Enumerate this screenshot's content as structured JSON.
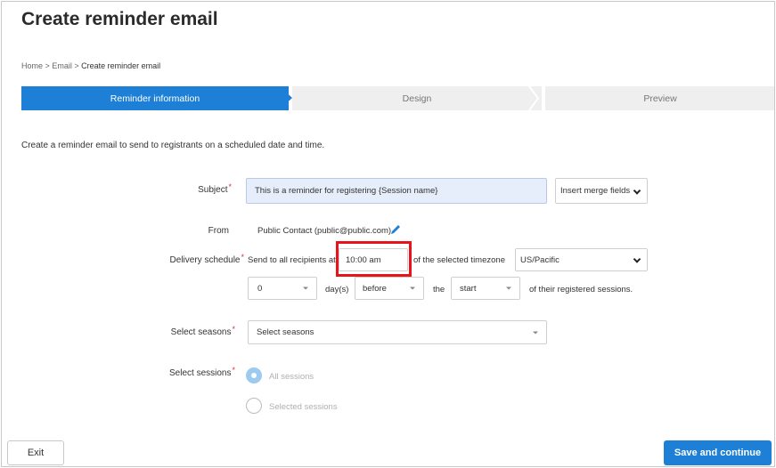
{
  "page": {
    "title": "Create reminder email"
  },
  "breadcrumb": {
    "home": "Home",
    "sep1": ">",
    "email": "Email",
    "sep2": ">",
    "current": "Create reminder email"
  },
  "steps": [
    {
      "label": "Reminder information",
      "active": true
    },
    {
      "label": "Design",
      "active": false
    },
    {
      "label": "Preview",
      "active": false
    }
  ],
  "intro": "Create a reminder email to send to registrants on a scheduled date and time.",
  "form": {
    "subject": {
      "label": "Subject",
      "required": "*",
      "value": "This is a reminder for registering {Session name}",
      "merge_button": "Insert merge fields"
    },
    "from": {
      "label": "From",
      "value": "Public Contact (public@public.com)"
    },
    "delivery": {
      "label": "Delivery schedule",
      "required": "*",
      "prefix": "Send to all recipients at",
      "time": "10:00 am",
      "tz_text": "of the selected timezone",
      "timezone": "US/Pacific",
      "days_value": "0",
      "days_label": "day(s)",
      "relation": "before",
      "the_label": "the",
      "anchor": "start",
      "suffix": "of their registered sessions."
    },
    "seasons": {
      "label": "Select seasons",
      "required": "*",
      "placeholder": "Select seasons"
    },
    "sessions": {
      "label": "Select sessions",
      "required": "*",
      "options": [
        "All sessions",
        "Selected sessions"
      ],
      "selected": "All sessions"
    }
  },
  "footer": {
    "exit": "Exit",
    "save": "Save and continue"
  },
  "colors": {
    "accent": "#1d7fd6",
    "highlight": "#e8141b",
    "required": "#dd3333"
  }
}
